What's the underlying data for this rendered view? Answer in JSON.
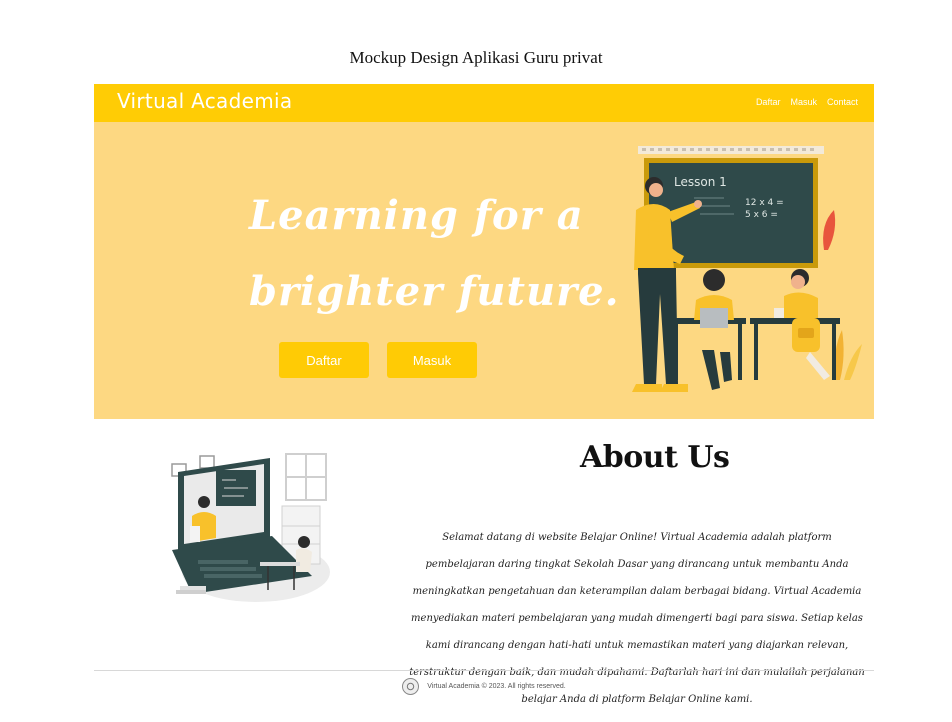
{
  "document": {
    "caption": "Mockup Design Aplikasi Guru privat"
  },
  "navbar": {
    "brand": "Virtual Academia",
    "links": [
      "Daftar",
      "Masuk",
      "Contact"
    ]
  },
  "hero": {
    "headline_line1": "Learning for a",
    "headline_line2": "brighter future.",
    "buttons": {
      "register": "Daftar",
      "login": "Masuk"
    },
    "board": {
      "title": "Lesson 1",
      "eq1": "12 x 4 =",
      "eq2": "5 x 6 ="
    }
  },
  "about": {
    "title": "About Us",
    "body": "Selamat datang di website Belajar Online! Virtual Academia adalah platform pembelajaran daring tingkat Sekolah Dasar yang dirancang untuk membantu Anda meningkatkan pengetahuan dan keterampilan dalam berbagai bidang. Virtual Academia menyediakan materi pembelajaran yang mudah dimengerti bagi para siswa. Setiap kelas kami dirancang dengan hati-hati untuk memastikan materi yang diajarkan relevan, terstruktur dengan baik, dan mudah dipahami. Daftarlah hari ini dan mulailah perjalanan belajar Anda di platform Belajar Online kami."
  },
  "footer": {
    "text": "Virtual Academia © 2023. All rights reserved."
  },
  "colors": {
    "primary": "#ffcc05",
    "hero_bg": "#fdd882",
    "board": "#2f4a4a"
  }
}
